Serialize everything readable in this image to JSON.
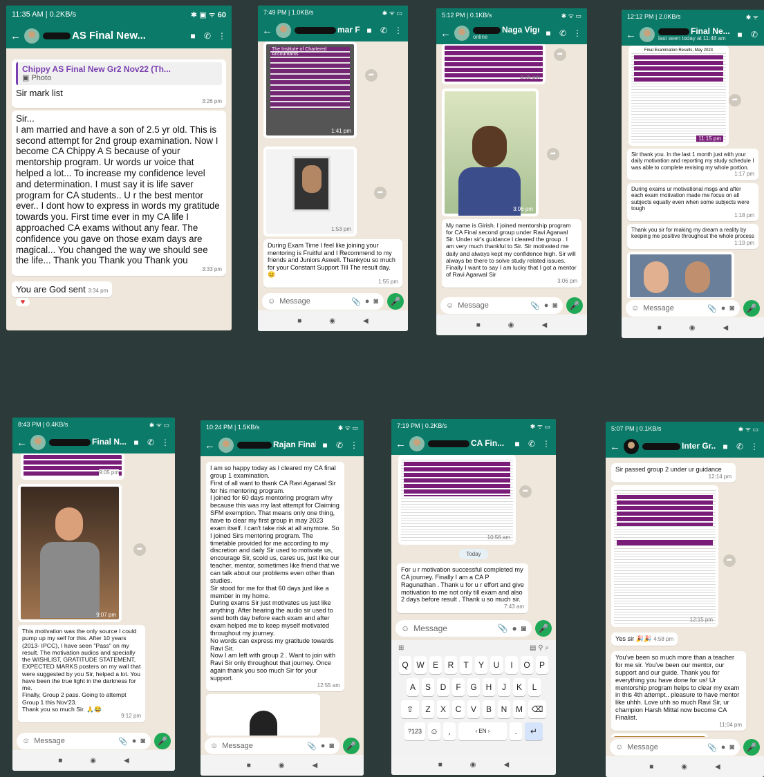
{
  "p1": {
    "status_time": "11:35 AM | 0.2KB/s",
    "battery": "60",
    "title": "AS Final New...",
    "quote_title": "Chippy AS Final New Gr2 Nov22 (Th...",
    "quote_sub": "Photo",
    "m1": "Sir mark list",
    "m1t": "3:26 pm",
    "m2": "Sir...\nI am married and have a son of 2.5 yr old. This is second attempt for 2nd group examination. Now I become CA Chippy A S because of your mentorship program. Ur words ur voice that helped a lot... To increase my confidence level and determination. I  must say it is life saver program for CA students.. U r the best mentor ever.. I dont how to express in words my gratitude towards you. First time ever in my CA life I approached CA exams without any fear. The confidence you gave on those exam days are magical... You changed the way we should see the life... Thank you Thank you Thank you",
    "m2t": "3:33 pm",
    "m3": "You are God sent",
    "m3t": "3:34 pm"
  },
  "p2": {
    "status_time": "7:49 PM | 1.0KB/s",
    "title": "mar Final N...",
    "doc_title": "The Institute of Chartered Accountants",
    "img1t": "1:41 pm",
    "img2t": "1:53 pm",
    "msg": "During Exam Time I feel like joining your mentoring is Fruitful and I Recommend to my friends and Juniors Aswell.  Thankyou so much for your Constant Support Till The result day.",
    "msgt": "1:55 pm",
    "placeholder": "Message"
  },
  "p3": {
    "status_time": "5:12 PM | 0.1KB/s",
    "title": "Naga Vigne...",
    "sub": "online",
    "imgt": "3:05 pm",
    "img2t": "3:06 pm",
    "msg": "My name is Girish. I joined mentorship program for CA Final second group under Ravi Agarwal Sir. Under sir's guidance i cleared the group . I am very much thankful to Sir. Sir motivated me daily and always kept my confidence high. Sir will always be there to solve study related issues. Finally I want to say I am lucky that I got a mentor of Ravi Agarwal Sir",
    "msgt": "3:06 pm",
    "placeholder": "Message"
  },
  "p4": {
    "status_time": "12:12 PM | 2.0KB/s",
    "title": "Final Ne...",
    "sub": "last seen today at 11:48 am",
    "doc_title": "Final Examination Results, May 2023",
    "doct": "11:15 pm",
    "m1": "Sir thank you. In the last 1 month just with your daily motivation and reporting my study schedule I was able to complete revising my whole portion.",
    "m1t": "1:17 pm",
    "m2": "During exams ur motivational msgs and after each exam motivation made me focus on all subjects equally even when some subjects were tough",
    "m2t": "1:18 pm",
    "m3": "Thank you sir for making my dream a reality by keeping me positive throughout the whole process",
    "m3t": "1:19 pm",
    "placeholder": "Message"
  },
  "p5": {
    "status_time": "8:43 PM | 0.4KB/s",
    "title": "Final N...",
    "img1t": "9:05 pm",
    "img2t": "9:07 pm",
    "msg": "This motivation was the only source I could pump up my self for this. After 10 years (2013- IPCC), I have seen \"Pass\" on my result. The motivation audios and specially the WISHLIST, GRATITUDE STATEMENT, EXPECTED MARKS posters on my wall that were suggested by you Sir, helped a lot. You have been the true light in the darkness for me.\nFinally, Group 2 pass. Going to attempt Group 1 this Nov'23.\nThank you so much Sir.",
    "msgt": "9:12 pm",
    "placeholder": "Message"
  },
  "p6": {
    "status_time": "10:24 PM | 1.5KB/s",
    "title": "Rajan Final...",
    "msg": "I am so happy today as I cleared my CA final group 1 examination.\nFirst of all want to thank CA Ravi Agarwal Sir for his mentoring program.\nI joined for 60 days mentoring program why because this was my last attempt for Claiming SFM exemption. That means only one thing, have to clear my first group in may 2023 exam itself. I can't take risk at all anymore. So I joined Sirs mentoring program. The timetable provided for me according to my discretion and daily Sir used to motivate us, encourage Sir, scold us, cares us, just like our teacher, mentor, sometimes like friend that we can talk about our problems even other than studies.\nSir stood for me for that 60 days just like a member in my home.\nDuring exams Sir just motivates us just like anything .After hearing the audio sir used to send both day before each exam and after exam helped me to keep myself motivated throughout my journey.\nNo words can express my gratitude towards Ravi Sir.\nNow I am left with group 2 . Want to join with Ravi Sir only throughout that journey. Once again thank you soo much Sir for your support.",
    "msgt": "12:55 am",
    "placeholder": "Message"
  },
  "p7": {
    "status_time": "7:19 PM | 0.2KB/s",
    "title": "CA Fin...",
    "doct": "10:56 am",
    "day": "Today",
    "msg": "For u r motivation successful completed my CA journey. Finally I am a CA P Ragunathan . Thank u for u r effort and give motivation to me not only till exam and also 2 days before result . Thank u so much sir.",
    "msgt": "7:43 am",
    "placeholder": "Message",
    "row1": [
      "Q",
      "W",
      "E",
      "R",
      "T",
      "Y",
      "U",
      "I",
      "O",
      "P"
    ],
    "row2": [
      "A",
      "S",
      "D",
      "F",
      "G",
      "H",
      "J",
      "K",
      "L"
    ],
    "row3": [
      "Z",
      "X",
      "C",
      "V",
      "B",
      "N",
      "M"
    ],
    "k123": "?123",
    "space": "‹ EN ›"
  },
  "p8": {
    "status_time": "5:07 PM | 0.1KB/s",
    "title": "Inter Gr...",
    "m1": "Sir passed group 2 under ur guidance",
    "m1t": "12:14 pm",
    "doct": "12:15 pm",
    "m2": "Yes sir",
    "m2t": "4:58 pm",
    "m3": "You've been so much more than a teacher for me sir. You've been our mentor, our support and our guide. Thank you for everything you have done for us!  Ur mentorship program helps to clear my exam in this 4th attempt.. pleasure to have mentor like uhhh. Love uhh so much Ravi Sir, ur champion Harsh Mittal now become CA Finalist.",
    "m3t": "11:04 pm",
    "placeholder": "Message"
  }
}
